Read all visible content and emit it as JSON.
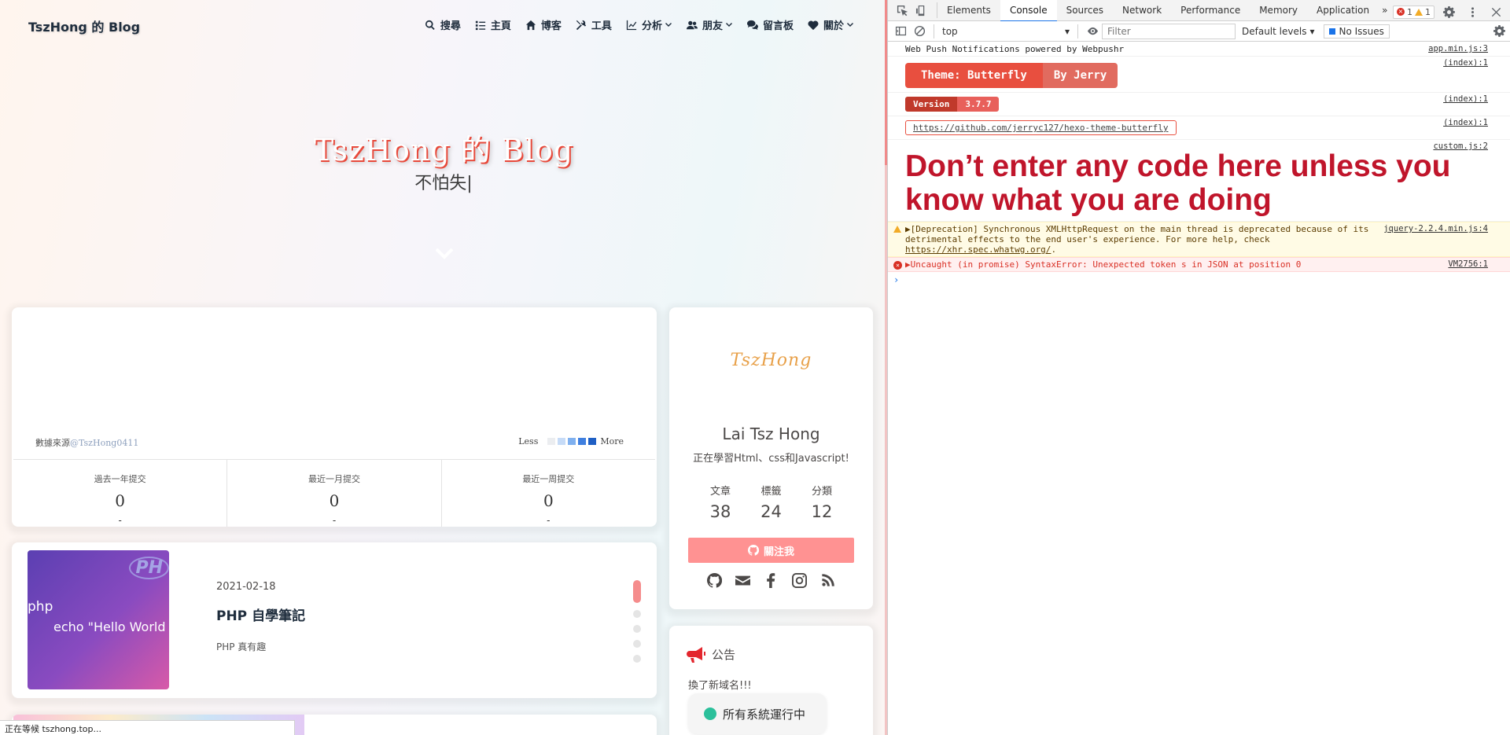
{
  "blog": {
    "site_name": "TszHong 的 Blog",
    "menu": [
      {
        "label": "搜尋",
        "icon": "search-icon"
      },
      {
        "label": "主頁",
        "icon": "list-icon"
      },
      {
        "label": "博客",
        "icon": "home-icon"
      },
      {
        "label": "工具",
        "icon": "tools-icon"
      },
      {
        "label": "分析",
        "icon": "chart-icon",
        "dropdown": true
      },
      {
        "label": "朋友",
        "icon": "users-icon",
        "dropdown": true
      },
      {
        "label": "留言板",
        "icon": "comments-icon"
      },
      {
        "label": "關於",
        "icon": "heart-icon",
        "dropdown": true
      }
    ],
    "hero": {
      "title": "TszHong 的 Blog",
      "subtitle": "不怕失|"
    },
    "calendar": {
      "source_label": "數據來源",
      "source_user": "@TszHong0411",
      "legend_less": "Less",
      "legend_more": "More",
      "legend_colors": [
        "#ebedf0",
        "#c6dbf7",
        "#7fb0ef",
        "#3f7fdf",
        "#1f5fc4"
      ],
      "stats": [
        {
          "label": "過去一年提交",
          "value": "0"
        },
        {
          "label": "最近一月提交",
          "value": "0"
        },
        {
          "label": "最近一周提交",
          "value": "0"
        }
      ]
    },
    "post": {
      "cover_tag": "PH",
      "cover_line1": "php",
      "cover_line2": "echo \"Hello World",
      "date": "2021-02-18",
      "title": "PHP 自學筆記",
      "description": "PHP 真有趣"
    },
    "author": {
      "logo_text": "TszHong",
      "name": "Lai Tsz Hong",
      "description": "正在學習Html、css和Javascript!",
      "stats": [
        {
          "label": "文章",
          "value": "38"
        },
        {
          "label": "標籤",
          "value": "24"
        },
        {
          "label": "分類",
          "value": "12"
        }
      ],
      "follow_label": "關注我",
      "social": [
        "github-icon",
        "envelope-icon",
        "facebook-icon",
        "instagram-icon",
        "rss-icon"
      ]
    },
    "announcement": {
      "title": "公告",
      "text": "換了新域名!!!",
      "status": "所有系統運行中"
    },
    "status_bar": "正在等候 tszhong.top..."
  },
  "devtools": {
    "tabs": [
      "Elements",
      "Console",
      "Sources",
      "Network",
      "Performance",
      "Memory",
      "Application"
    ],
    "active_tab": "Console",
    "more_tabs": "»",
    "error_count": "1",
    "warning_count": "1",
    "context": "top",
    "filter_placeholder": "Filter",
    "levels": "Default levels",
    "issues": "No Issues",
    "console": {
      "line1": {
        "text": "Web Push Notifications powered by Webpushr",
        "source": "app.min.js:3"
      },
      "theme_badge": {
        "left": "Theme: Butterfly",
        "right": "By Jerry",
        "source": "(index):1"
      },
      "version_badge": {
        "left": "Version",
        "right": "3.7.7",
        "source": "(index):1"
      },
      "repo_link": {
        "text": "https://github.com/jerryc127/hexo-theme-butterfly",
        "source": "(index):1"
      },
      "warning_big": {
        "text": "Don’t enter any code here unless you know what you are doing",
        "source": "custom.js:2"
      },
      "deprecation": {
        "text": "▶[Deprecation] Synchronous XMLHttpRequest on the main thread is deprecated because of its detrimental effects to the end user's experience. For more help, check ",
        "link": "https://xhr.spec.whatwg.org/",
        "tail": ".",
        "source": "jquery-2.2.4.min.js:4"
      },
      "error": {
        "text": "▶Uncaught (in promise) SyntaxError: Unexpected token s in JSON at position 0",
        "source": "VM2756:1"
      },
      "prompt": "›"
    }
  }
}
